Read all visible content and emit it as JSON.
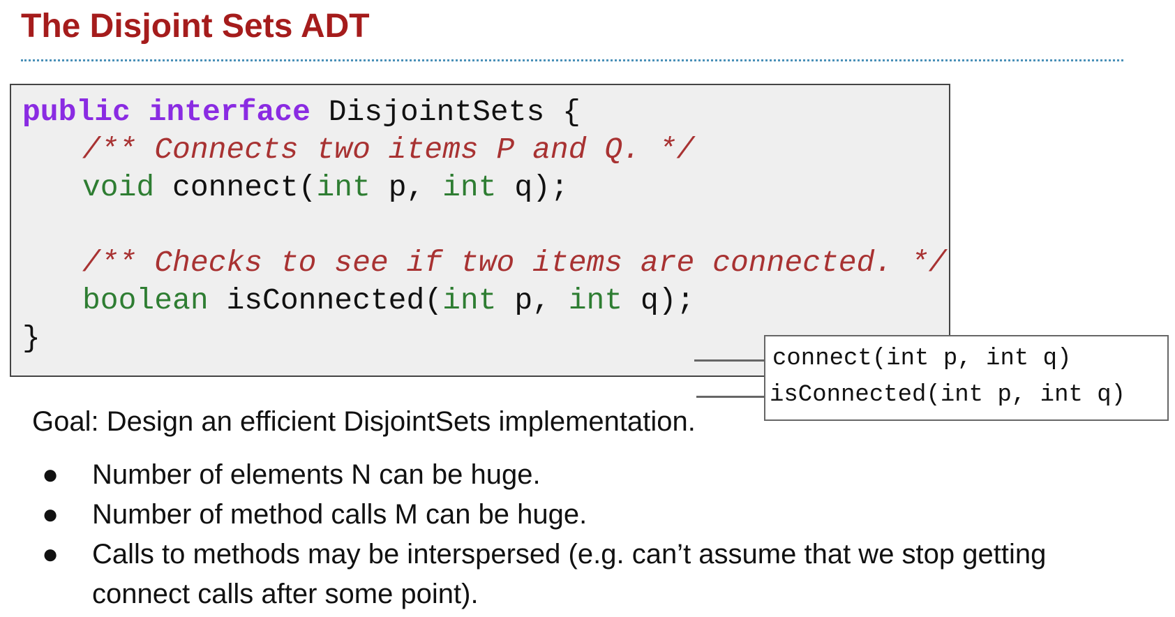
{
  "slide": {
    "title": "The Disjoint Sets ADT"
  },
  "code": {
    "line1": {
      "kw1": "public",
      "kw2": "interface",
      "rest": " DisjointSets {"
    },
    "line2": {
      "comment": "/** Connects two items P and Q. */"
    },
    "line3": {
      "type1": "void",
      "mid1": " connect(",
      "type2": "int",
      "mid2": " p, ",
      "type3": "int",
      "end": " q);"
    },
    "line5": {
      "comment": "/** Checks to see if two items are connected. */"
    },
    "line6": {
      "type1": "boolean",
      "mid1": " isConnected(",
      "type2": "int",
      "mid2": " p, ",
      "type3": "int",
      "end": " q);"
    },
    "line7": {
      "brace": "}"
    }
  },
  "popup": {
    "items": [
      "connect(int p, int q)",
      "isConnected(int p, int q)"
    ]
  },
  "goal": "Goal: Design an efficient DisjointSets implementation.",
  "bullets": {
    "symbol": "●",
    "items": [
      "Number of elements N can be huge.",
      "Number of method calls M can be huge.",
      "Calls to methods may be interspersed (e.g. can’t assume that we stop getting connect calls after some point)."
    ]
  }
}
